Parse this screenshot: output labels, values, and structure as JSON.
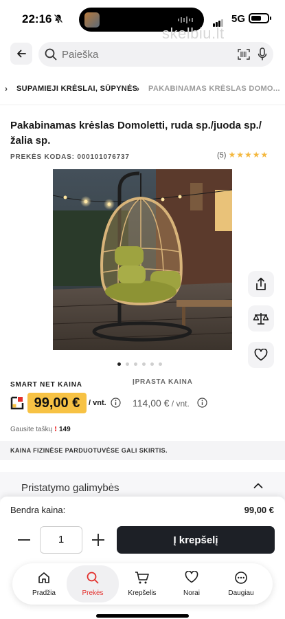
{
  "status_bar": {
    "time": "22:16",
    "network": "5G",
    "battery_level": 0.62
  },
  "watermark": "skelbiu.lt",
  "search": {
    "placeholder": "Paieška"
  },
  "breadcrumb": {
    "items": [
      "SUPAMIEJI KRĖSLAI, SŪPYNĖS",
      "PAKABINAMAS KRĖSLAS DOMO..."
    ]
  },
  "product": {
    "title": "Pakabinamas krėslas Domoletti, ruda sp./juoda sp./ žalia sp.",
    "code_label": "PREKĖS KODAS:",
    "code": "000101076737",
    "rating_count": "(5)",
    "rating_stars": 5,
    "image_count": 6,
    "image_active": 1
  },
  "prices": {
    "smart_label": "SMART NET KAINA",
    "smart_price": "99,00 €",
    "smart_unit": "/ vnt.",
    "regular_label": "ĮPRASTA KAINA",
    "regular_price": "114,00 €",
    "regular_unit": " / vnt."
  },
  "points": {
    "label": "Gausite taškų",
    "value": "149"
  },
  "notice": "KAINA FIZINĖSE PARDUOTUVĖSE GALI SKIRTIS.",
  "delivery": {
    "label": "Pristatymo galimybės"
  },
  "cart": {
    "total_label": "Bendra kaina:",
    "total_value": "99,00 €",
    "quantity": "1",
    "add_label": "Į krepšelį"
  },
  "nav": {
    "active": "Prekės",
    "items": [
      {
        "label": "Pradžia",
        "icon": "home-icon"
      },
      {
        "label": "Prekės",
        "icon": "search-icon"
      },
      {
        "label": "Krepšelis",
        "icon": "cart-icon"
      },
      {
        "label": "Norai",
        "icon": "heart-icon"
      },
      {
        "label": "Daugiau",
        "icon": "more-icon"
      }
    ]
  },
  "colors": {
    "accent_red": "#e3312d",
    "price_yellow": "#f7c244",
    "button_dark": "#1d2026",
    "star": "#f4b83f"
  }
}
